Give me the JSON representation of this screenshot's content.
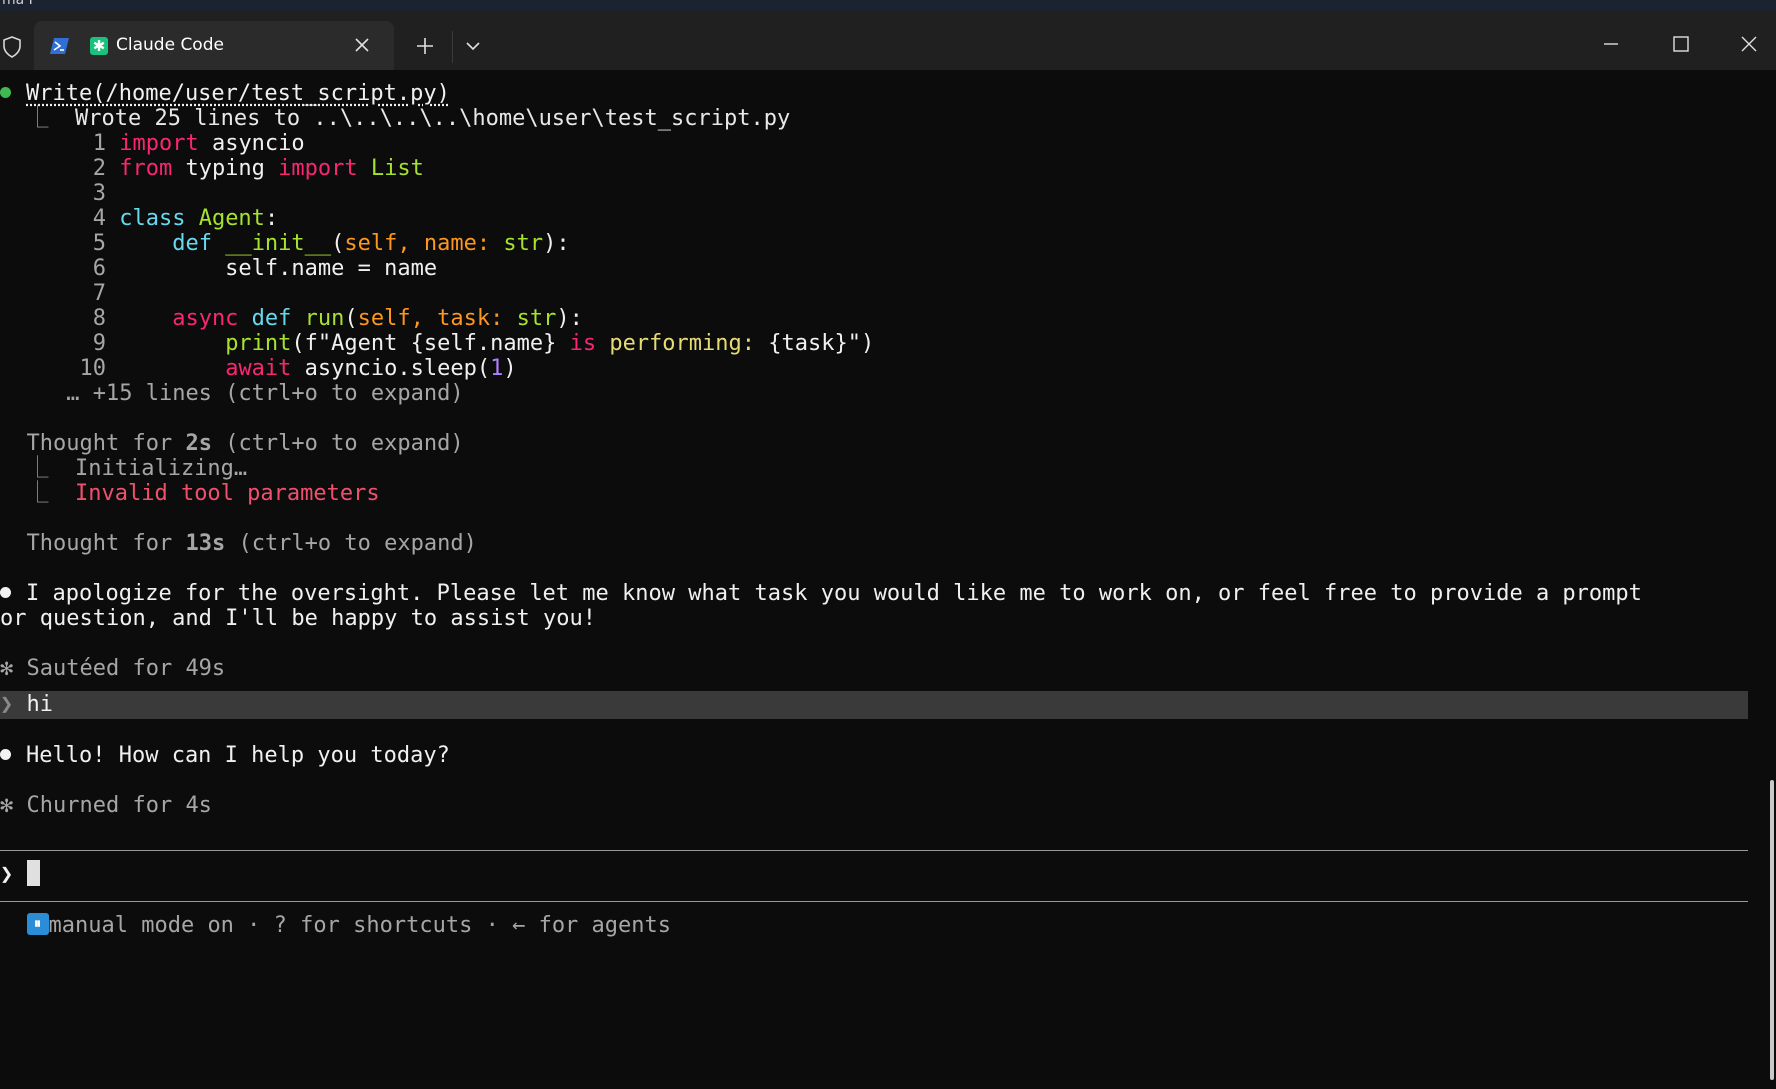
{
  "desktop": {
    "fragment": "ma I"
  },
  "tabbar": {
    "tab_title": "Claude Code"
  },
  "write_block": {
    "tool_call": "Write(/home/user/test_script.py)",
    "result": "Wrote 25 lines to ..\\..\\..\\..\\home\\user\\test_script.py",
    "code_lines": [
      {
        "n": "1"
      },
      {
        "n": "2"
      },
      {
        "n": "3"
      },
      {
        "n": "4"
      },
      {
        "n": "5"
      },
      {
        "n": "6"
      },
      {
        "n": "7"
      },
      {
        "n": "8"
      },
      {
        "n": "9"
      },
      {
        "n": "10"
      }
    ],
    "more": "… +15 lines (ctrl+o to expand)"
  },
  "code": {
    "l1_kw": "import",
    "l1_rest": " asyncio",
    "l2_kw1": "from",
    "l2_mid": " typing ",
    "l2_kw2": "import",
    "l2_rest": " List",
    "l4_kw": "class",
    "l4_name": " Agent",
    "l4_colon": ":",
    "l5_indent": "    ",
    "l5_kw": "def",
    "l5_fn": " __init__",
    "l5_p1": "(",
    "l5_self": "self, name: ",
    "l5_type": "str",
    "l5_end": "):",
    "l6_text": "        self.name = name",
    "l8_indent": "    ",
    "l8_kw1": "async",
    "l8_kw2": " def",
    "l8_fn": " run",
    "l8_p1": "(",
    "l8_params": "self, task: ",
    "l8_type": "str",
    "l8_end": "):",
    "l9_indent": "        ",
    "l9_fn": "print",
    "l9_p": "(f\"Agent {self.name} ",
    "l9_is": "is",
    "l9_rest1": " performing: ",
    "l9_rest2": "{task}\")",
    "l10_indent": "        ",
    "l10_kw": "await",
    "l10_rest": " asyncio.sleep(",
    "l10_num": "1",
    "l10_end": ")"
  },
  "thought1": {
    "prefix": "Thought for ",
    "time": "2s",
    "suffix": " (ctrl+o to expand)"
  },
  "thought1_children": [
    "Initializing…",
    "Invalid tool parameters"
  ],
  "thought2": {
    "prefix": "Thought for ",
    "time": "13s",
    "suffix": " (ctrl+o to expand)"
  },
  "reply1": {
    "line1": "I apologize for the oversight. Please let me know what task you would like me to work on, or feel free to provide a prompt",
    "line2": "or question, and I'll be happy to assist you!"
  },
  "status1": "Sautéed for 49s",
  "user_prompt": "hi",
  "reply2": "Hello! How can I help you today?",
  "status2": "Churned for 4s",
  "footer": {
    "text": "manual mode on · ? for shortcuts · ← for agents"
  },
  "colors": {
    "keyword": "#f92672",
    "builtin": "#66d9ef",
    "name": "#a6e22e",
    "param": "#fd971f",
    "string": "#e6db74",
    "error": "#f0506e",
    "mode_badge": "#2b8cd8"
  }
}
